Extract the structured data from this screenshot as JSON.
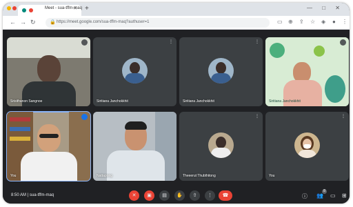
{
  "browser": {
    "tab_title": "Meet - sua-tffm-maq",
    "new_tab_symbol": "+",
    "url": "https://meet.google.com/sua-tffm-maq?authuser=1"
  },
  "participants": [
    {
      "name": "Srisithanon Sangnoe",
      "kind": "video"
    },
    {
      "name": "Siritiana Janchokkhit",
      "kind": "avatar"
    },
    {
      "name": "Siritiana Janchokkhit",
      "kind": "avatar"
    },
    {
      "name": "Siritiana Janchokkhit",
      "kind": "video"
    },
    {
      "name": "You",
      "kind": "video",
      "active": true
    },
    {
      "name": "Nattapong",
      "kind": "video"
    },
    {
      "name": "Theeerut Thubthitong",
      "kind": "avatar"
    },
    {
      "name": "You",
      "kind": "avatar"
    }
  ],
  "meeting": {
    "time": "8:50 AM",
    "separator": "|",
    "code": "sua-tffm-maq",
    "participants_badge": "8"
  },
  "colors": {
    "background": "#202124",
    "tile": "#3c4043",
    "accent_red": "#ea4335",
    "active_outline": "#8ab4f8"
  }
}
